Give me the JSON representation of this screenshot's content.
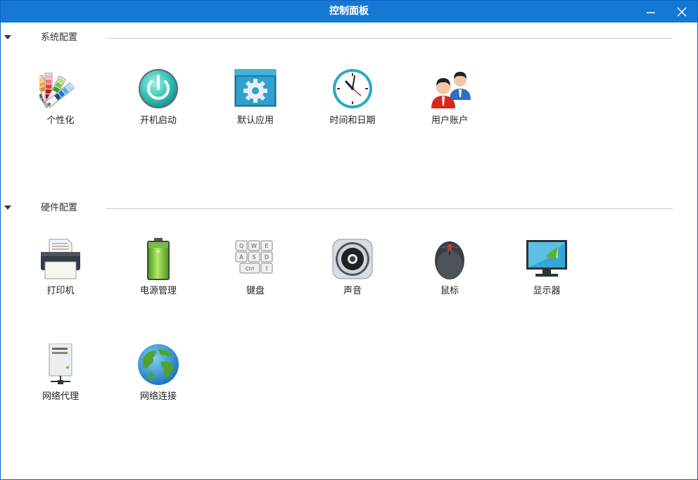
{
  "window": {
    "title": "控制面板",
    "minimize_label": "minimize",
    "close_label": "close"
  },
  "sections": [
    {
      "label": "系统配置",
      "items": [
        {
          "label": "个性化",
          "icon": "color-palette-icon"
        },
        {
          "label": "开机启动",
          "icon": "power-icon"
        },
        {
          "label": "默认应用",
          "icon": "gear-window-icon"
        },
        {
          "label": "时间和日期",
          "icon": "clock-icon"
        },
        {
          "label": "用户账户",
          "icon": "users-icon"
        }
      ]
    },
    {
      "label": "硬件配置",
      "items": [
        {
          "label": "打印机",
          "icon": "printer-icon"
        },
        {
          "label": "电源管理",
          "icon": "battery-icon"
        },
        {
          "label": "键盘",
          "icon": "keyboard-icon"
        },
        {
          "label": "声音",
          "icon": "speaker-icon"
        },
        {
          "label": "鼠标",
          "icon": "mouse-icon"
        },
        {
          "label": "显示器",
          "icon": "monitor-icon"
        },
        {
          "label": "网络代理",
          "icon": "server-icon"
        },
        {
          "label": "网络连接",
          "icon": "globe-icon"
        }
      ]
    }
  ],
  "colors": {
    "titlebar": "#1479d5",
    "border": "#0a64c8"
  }
}
